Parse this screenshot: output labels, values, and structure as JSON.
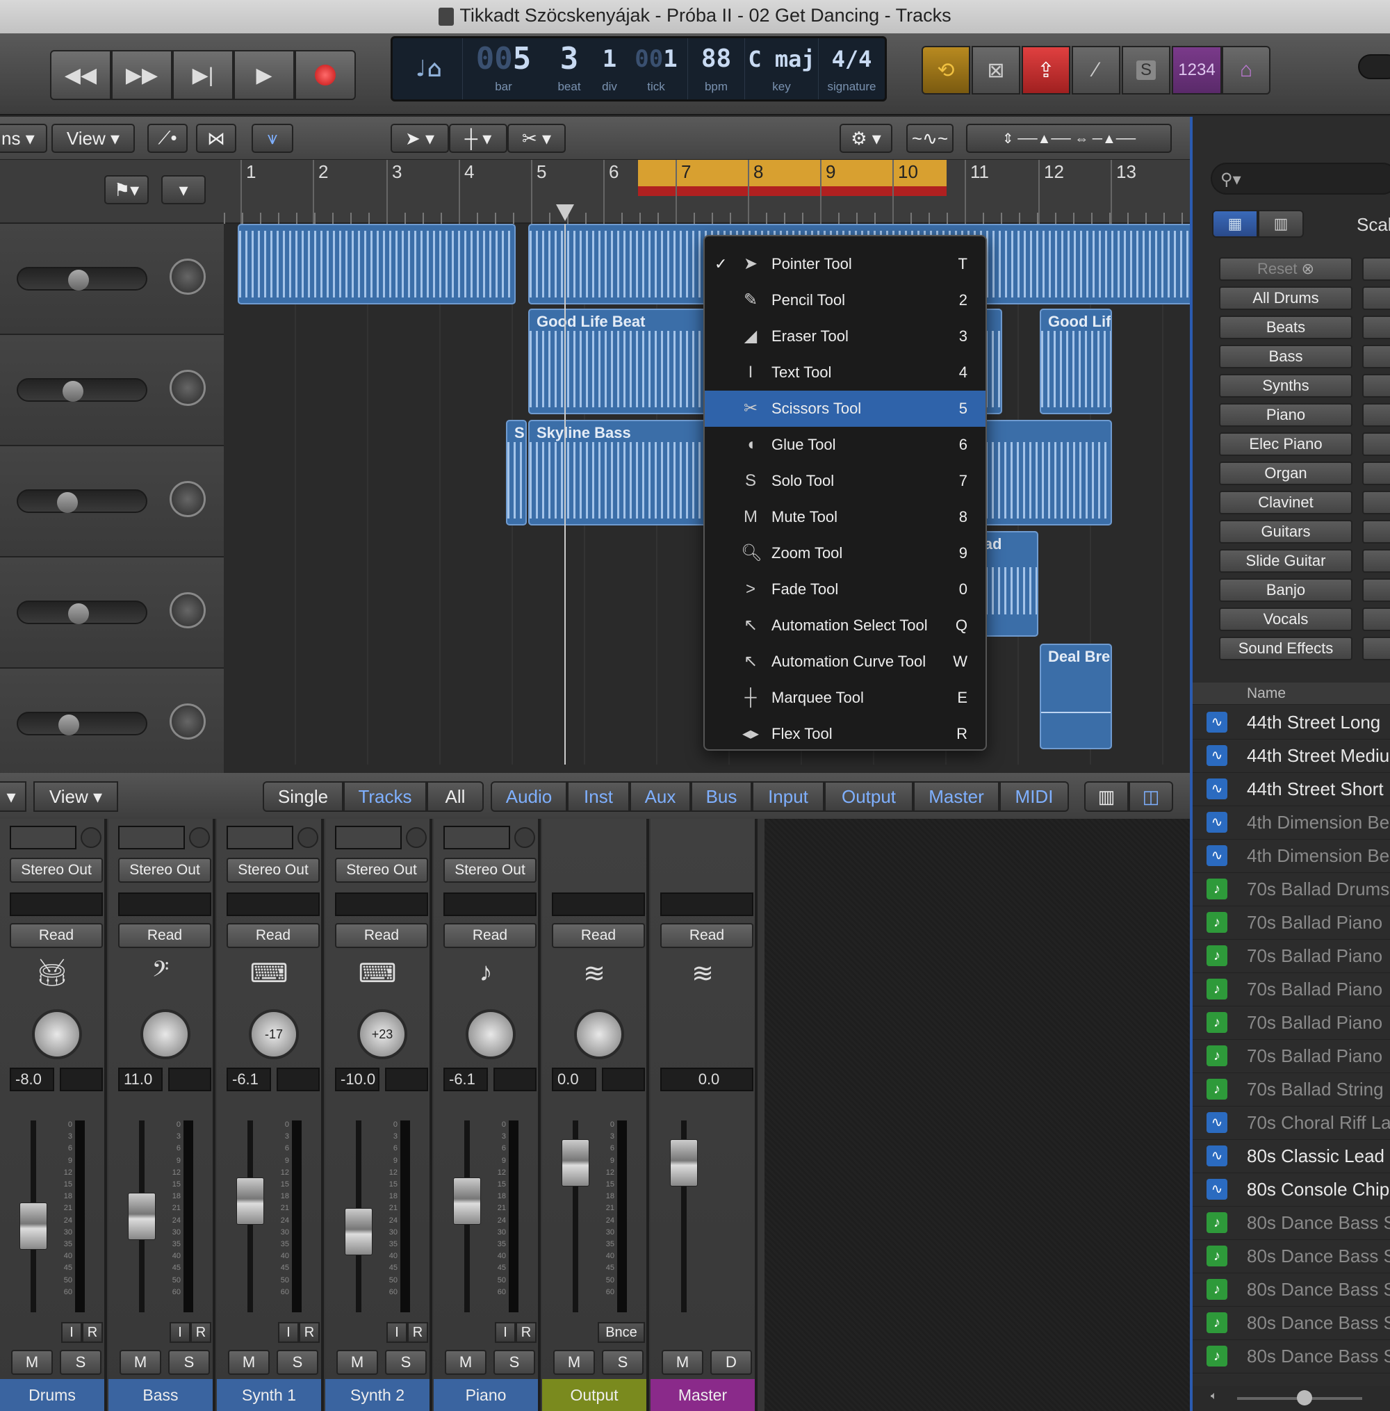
{
  "window": {
    "title": "Tikkadt Szöcskenyájak - Próba II - 02 Get Dancing - Tracks"
  },
  "transport": {
    "buttons": [
      "rewind",
      "fast-forward",
      "go-to-end",
      "play",
      "record"
    ],
    "lcd": {
      "bar": "5",
      "bar_prefix": "00",
      "beat": "3",
      "div": "1",
      "tick": "1",
      "tick_prefix": "00",
      "bpm": "88",
      "key": "C maj",
      "signature": "4/4",
      "labels": {
        "bar": "bar",
        "beat": "beat",
        "div": "div",
        "tick": "tick",
        "bpm": "bpm",
        "key": "key",
        "signature": "signature"
      }
    },
    "count_in": "1234",
    "solo": "S"
  },
  "tracks_header": {
    "ns_label": "ns",
    "view_label": "View"
  },
  "ruler": {
    "bars": [
      "1",
      "2",
      "3",
      "4",
      "5",
      "6",
      "7",
      "8",
      "9",
      "10",
      "11",
      "12",
      "13"
    ]
  },
  "regions": {
    "good_life_beat": "Good Life Beat",
    "good_life_short": "Good Lif",
    "skyline_bass": "Skyline Bass",
    "sl": "Sl",
    "barricade": "arricad",
    "deal_breaker": "Deal Bre"
  },
  "tool_menu": {
    "items": [
      {
        "label": "Pointer Tool",
        "key": "T",
        "icon": "pointer-icon",
        "checked": true
      },
      {
        "label": "Pencil Tool",
        "key": "2",
        "icon": "pencil-icon"
      },
      {
        "label": "Eraser Tool",
        "key": "3",
        "icon": "eraser-icon"
      },
      {
        "label": "Text Tool",
        "key": "4",
        "icon": "text-cursor-icon"
      },
      {
        "label": "Scissors Tool",
        "key": "5",
        "icon": "scissors-icon",
        "selected": true
      },
      {
        "label": "Glue Tool",
        "key": "6",
        "icon": "glue-icon"
      },
      {
        "label": "Solo Tool",
        "key": "7",
        "icon": "solo-icon"
      },
      {
        "label": "Mute Tool",
        "key": "8",
        "icon": "mute-icon"
      },
      {
        "label": "Zoom Tool",
        "key": "9",
        "icon": "zoom-icon"
      },
      {
        "label": "Fade Tool",
        "key": "0",
        "icon": "fade-icon"
      },
      {
        "label": "Automation Select Tool",
        "key": "Q",
        "icon": "automation-select-icon"
      },
      {
        "label": "Automation Curve Tool",
        "key": "W",
        "icon": "automation-curve-icon"
      },
      {
        "label": "Marquee Tool",
        "key": "E",
        "icon": "marquee-icon"
      },
      {
        "label": "Flex Tool",
        "key": "R",
        "icon": "flex-icon"
      }
    ]
  },
  "mixer_header": {
    "view_label": "View",
    "scope_tabs": [
      "Single",
      "Tracks",
      "All"
    ],
    "filter_tabs": [
      "Audio",
      "Inst",
      "Aux",
      "Bus",
      "Input",
      "Output",
      "Master",
      "MIDI"
    ]
  },
  "mixer": {
    "strips": [
      {
        "name": "Drums",
        "output": "Stereo Out",
        "automation": "Read",
        "pan": "",
        "volume": "-8.0",
        "fader_level": 0.45,
        "color": "#3a64a0"
      },
      {
        "name": "Bass",
        "output": "Stereo Out",
        "automation": "Read",
        "pan": "",
        "volume": "11.0",
        "fader_level": 0.5,
        "color": "#3a64a0"
      },
      {
        "name": "Synth 1",
        "output": "Stereo Out",
        "automation": "Read",
        "pan": "-17",
        "volume": "-6.1",
        "fader_level": 0.58,
        "color": "#3a64a0"
      },
      {
        "name": "Synth 2",
        "output": "Stereo Out",
        "automation": "Read",
        "pan": "+23",
        "volume": "-10.0",
        "fader_level": 0.42,
        "color": "#3a64a0"
      },
      {
        "name": "Piano",
        "output": "Stereo Out",
        "automation": "Read",
        "pan": "",
        "volume": "-6.1",
        "fader_level": 0.58,
        "color": "#3a64a0"
      },
      {
        "name": "Output",
        "output": "",
        "automation": "Read",
        "pan": "",
        "volume": "0.0",
        "fader_level": 0.78,
        "color": "#7a8a1e"
      },
      {
        "name": "Master",
        "output": "",
        "automation": "Read",
        "pan": "",
        "volume": "0.0",
        "fader_level": 0.78,
        "color": "#8a2a8a"
      }
    ],
    "meter_scale": [
      "0",
      "3",
      "6",
      "9",
      "12",
      "15",
      "18",
      "21",
      "24",
      "30",
      "35",
      "40",
      "45",
      "50",
      "60"
    ],
    "labels": {
      "mute": "M",
      "solo": "S",
      "dim": "D",
      "input": "I",
      "record": "R",
      "bounce": "Bnce"
    }
  },
  "library": {
    "search_placeholder": "",
    "scale_label": "Scal",
    "reset": "Reset",
    "categories": [
      "All Drums",
      "Beats",
      "Bass",
      "Synths",
      "Piano",
      "Elec Piano",
      "Organ",
      "Clavinet",
      "Guitars",
      "Slide Guitar",
      "Banjo",
      "Vocals",
      "Sound Effects"
    ],
    "name_header": "Name",
    "loops": [
      {
        "name": "44th Street Long",
        "type": "audio",
        "dim": false
      },
      {
        "name": "44th Street Mediu",
        "type": "audio",
        "dim": false
      },
      {
        "name": "44th Street Short",
        "type": "audio",
        "dim": false
      },
      {
        "name": "4th Dimension Be",
        "type": "audio",
        "dim": true
      },
      {
        "name": "4th Dimension Be",
        "type": "audio",
        "dim": true
      },
      {
        "name": "70s Ballad Drums",
        "type": "midi",
        "dim": true
      },
      {
        "name": "70s Ballad Piano",
        "type": "midi",
        "dim": true
      },
      {
        "name": "70s Ballad Piano",
        "type": "midi",
        "dim": true
      },
      {
        "name": "70s Ballad Piano",
        "type": "midi",
        "dim": true
      },
      {
        "name": "70s Ballad Piano",
        "type": "midi",
        "dim": true
      },
      {
        "name": "70s Ballad Piano",
        "type": "midi",
        "dim": true
      },
      {
        "name": "70s Ballad String",
        "type": "midi",
        "dim": true
      },
      {
        "name": "70s Choral Riff La",
        "type": "audio",
        "dim": true
      },
      {
        "name": "80s Classic Lead",
        "type": "audio",
        "dim": false
      },
      {
        "name": "80s Console Chip",
        "type": "audio",
        "dim": false
      },
      {
        "name": "80s Dance Bass S",
        "type": "midi",
        "dim": true
      },
      {
        "name": "80s Dance Bass S",
        "type": "midi",
        "dim": true
      },
      {
        "name": "80s Dance Bass S",
        "type": "midi",
        "dim": true
      },
      {
        "name": "80s Dance Bass S",
        "type": "midi",
        "dim": true
      },
      {
        "name": "80s Dance Bass S",
        "type": "midi",
        "dim": true
      }
    ]
  },
  "colors": {
    "accent": "#2f63aa",
    "audio_loop": "#2b6bc0",
    "midi_loop": "#2e9a3a",
    "cycle": "#d8a030"
  }
}
